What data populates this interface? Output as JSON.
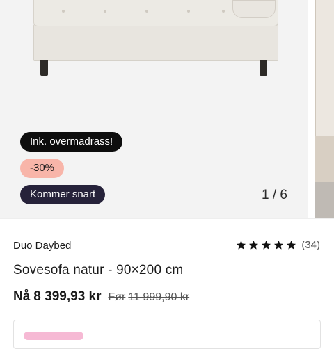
{
  "gallery": {
    "badges": {
      "promo": "Ink. overmadrass!",
      "discount": "-30%",
      "availability": "Kommer snart"
    },
    "counter": "1 / 6"
  },
  "product": {
    "brand": "Duo Daybed",
    "title": "Sovesofa natur - 90×200 cm",
    "rating": {
      "stars": 5,
      "max": 5,
      "count_label": "(34)"
    },
    "price": {
      "now_prefix": "Nå",
      "now": "8 399,93 kr",
      "before_prefix": "Før",
      "before": "11 999,90 kr"
    }
  },
  "colors": {
    "discount_badge": "#f8b5a9",
    "promo_badge": "#0d0d0d",
    "availability_badge": "#26223a",
    "card_tag": "#f6b9d4"
  },
  "icons": {
    "star": "star-icon"
  }
}
